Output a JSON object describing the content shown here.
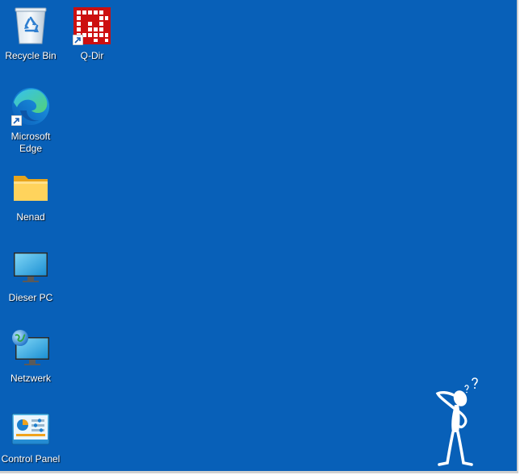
{
  "desktop": {
    "background_color": "#0860b8",
    "icons": [
      {
        "id": "recycle-bin",
        "label": "Recycle Bin",
        "icon": "recycle-bin-icon"
      },
      {
        "id": "q-dir",
        "label": "Q-Dir",
        "icon": "q-dir-icon",
        "shortcut": true
      },
      {
        "id": "microsoft-edge",
        "label": "Microsoft\nEdge",
        "icon": "edge-icon",
        "shortcut": true
      },
      {
        "id": "nenad",
        "label": "Nenad",
        "icon": "folder-icon"
      },
      {
        "id": "dieser-pc",
        "label": "Dieser PC",
        "icon": "monitor-icon"
      },
      {
        "id": "netzwerk",
        "label": "Netzwerk",
        "icon": "network-icon"
      },
      {
        "id": "control-panel",
        "label": "Control Panel",
        "icon": "control-panel-icon"
      }
    ]
  },
  "decoration": {
    "mascot": "thinking-stickman-icon"
  }
}
